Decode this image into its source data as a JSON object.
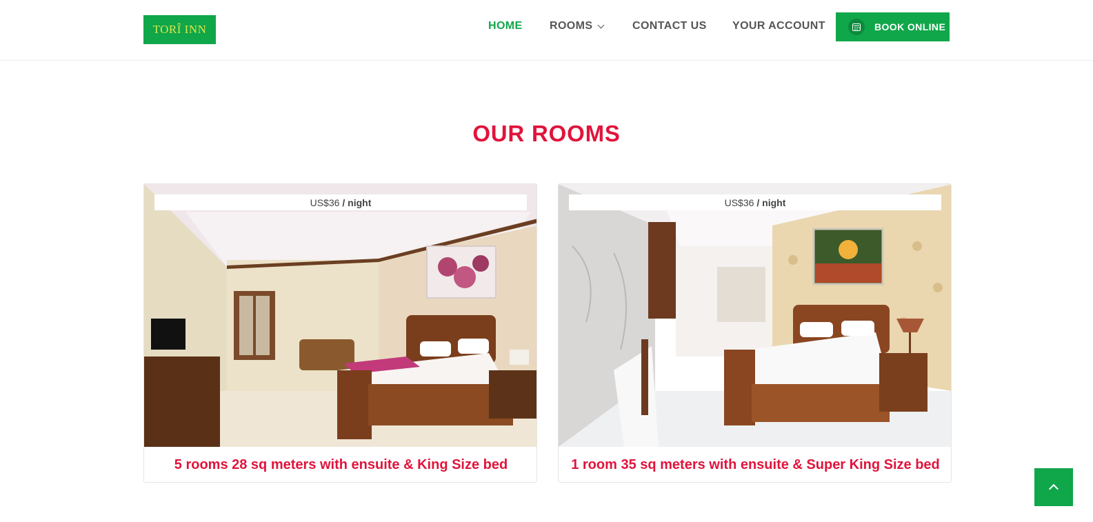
{
  "header": {
    "logo_text": "TORÎ INN",
    "nav": {
      "home": "HOME",
      "rooms": "ROOMS",
      "contact": "CONTACT US",
      "account": "YOUR ACCOUNT"
    },
    "book_button": "BOOK ONLINE",
    "book_icon": "calendar-icon"
  },
  "section": {
    "title": "OUR ROOMS"
  },
  "rooms": [
    {
      "price": "US$36",
      "per": "/ night",
      "title": "5 rooms 28 sq meters with ensuite & King Size bed"
    },
    {
      "price": "US$36",
      "per": "/ night",
      "title": "1 room 35 sq meters with ensuite & Super King Size bed"
    }
  ],
  "colors": {
    "brand_green": "#10a64a",
    "accent_red": "#e0143c"
  },
  "scroll_top_icon": "chevron-up-icon"
}
